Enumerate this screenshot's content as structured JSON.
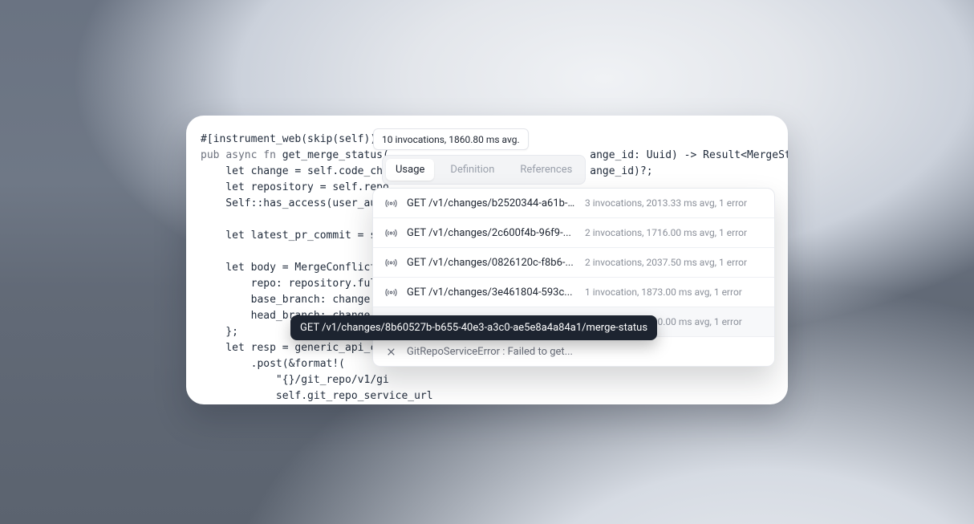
{
  "code": {
    "attr": "#[instrument_web(skip(self))]",
    "sig_prefix": "pub ",
    "sig_async": "async ",
    "sig_fn": "fn ",
    "sig_name": "get_merge_status(",
    "sig_tail_visible": "                                ange_id: Uuid) -> Result<MergeStatus,",
    "body": "    let change = self.code_cha                                ange_id)?;\n    let repository = self.repo\n    Self::has_access(user_auth\n\n    let latest_pr_commit = sel\n\n    let body = MergeConflictPa\n        repo: repository.full_\n        base_branch: change.ba\n        head_branch: change.he                                    s avg, 1 error\n    };\n    let resp = generic_api_cli\n        .post(&format!(\n            \"{}/git_repo/v1/gi\n            self.git_repo_service_url"
  },
  "badge": "10 invocations, 1860.80 ms avg.",
  "tabs": {
    "usage": "Usage",
    "definition": "Definition",
    "references": "References"
  },
  "popover": {
    "items": [
      {
        "label": "GET /v1/changes/b2520344-a61b-...",
        "stats": "3 invocations, 2013.33 ms avg, 1 error"
      },
      {
        "label": "GET /v1/changes/2c600f4b-96f9-...",
        "stats": "2 invocations, 1716.00 ms avg, 1 error"
      },
      {
        "label": "GET /v1/changes/0826120c-f8b6-...",
        "stats": "2 invocations, 2037.50 ms avg, 1 error"
      },
      {
        "label": "GET /v1/changes/3e461804-593c...",
        "stats": "1 invocation, 1873.00 ms avg, 1 error"
      },
      {
        "label": "GET /v1/changes/8b60527b-b655...",
        "stats": "1 invocation, 1820.00 ms avg, 1 error"
      }
    ],
    "error": {
      "label": "GitRepoServiceError : Failed to get..."
    }
  },
  "tooltip": "GET /v1/changes/8b60527b-b655-40e3-a3c0-ae5e8a4a84a1/merge-status"
}
